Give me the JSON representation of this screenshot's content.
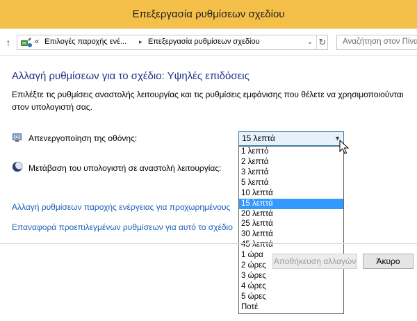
{
  "window": {
    "title": "Επεξεργασία ρυθμίσεων σχεδίου"
  },
  "navigation": {
    "up_glyph": "↑",
    "breadcrumb_overflow": "«",
    "separator_glyph": "▸",
    "crumbs": [
      "Επιλογές παροχής ενέ...",
      "Επεξεργασία ρυθμίσεων σχεδίου"
    ],
    "dropdown_glyph": "⌄",
    "refresh_glyph": "↻",
    "search_placeholder": "Αναζήτηση στον Πίνακα Ελέγχου"
  },
  "main": {
    "heading": "Αλλαγή ρυθμίσεων για το σχέδιο: Υψηλές επιδόσεις",
    "description": "Επιλέξτε τις ρυθμίσεις αναστολής λειτουργίας και τις ρυθμίσεις εμφάνισης που θέλετε να χρησιμοποιούνται στον υπολογιστή σας.",
    "display_off_label": "Απενεργοποίηση της οθόνης:",
    "sleep_label": "Μετάβαση του υπολογιστή σε αναστολή λειτουργίας:",
    "display_off_value": "15 λεπτά",
    "dropdown_arrow": "▼",
    "dropdown_options": [
      "1 λεπτό",
      "2 λεπτά",
      "3 λεπτά",
      "5 λεπτά",
      "10 λεπτά",
      "15 λεπτά",
      "20 λεπτά",
      "25 λεπτά",
      "30 λεπτά",
      "45 λεπτά",
      "1 ώρα",
      "2 ώρες",
      "3 ώρες",
      "4 ώρες",
      "5 ώρες",
      "Ποτέ"
    ],
    "selected_index": 5,
    "advanced_link": "Αλλαγή ρυθμίσεων παροχής ενέργειας για προχωρημένους",
    "restore_link": "Επαναφορά προεπιλεγμένων ρυθμίσεων για αυτό το σχέδιο"
  },
  "footer": {
    "save_label": "Αποθήκευση αλλαγών",
    "cancel_label": "Άκυρο"
  },
  "colors": {
    "titlebar": "#f5c04a",
    "heading": "#1e3287",
    "link": "#1a5fb4",
    "selection": "#3399ff"
  }
}
